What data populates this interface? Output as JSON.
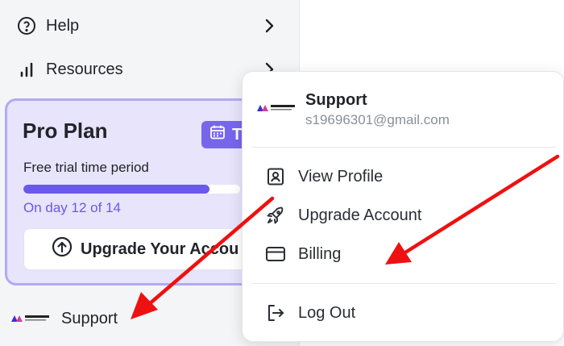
{
  "sidebar": {
    "nav": [
      {
        "label": "Help",
        "icon": "help-circle-icon"
      },
      {
        "label": "Resources",
        "icon": "bar-chart-icon"
      }
    ],
    "plan": {
      "title": "Pro Plan",
      "badge": "T",
      "trial_text": "Free trial time period",
      "progress_fraction": 0.857,
      "day_text": "On day 12 of 14",
      "upgrade_label": "Upgrade Your Accou"
    },
    "support": {
      "label": "Support"
    }
  },
  "popover": {
    "name": "Support",
    "email": "s19696301@gmail.com",
    "items": [
      {
        "label": "View Profile",
        "icon": "profile-icon"
      },
      {
        "label": "Upgrade Account",
        "icon": "rocket-icon"
      },
      {
        "label": "Billing",
        "icon": "credit-card-icon"
      }
    ],
    "logout_label": "Log Out"
  },
  "colors": {
    "accent": "#6a59e8",
    "badge": "#7766ec",
    "card_bg": "#e7e4fb",
    "arrow": "#ee1111"
  }
}
